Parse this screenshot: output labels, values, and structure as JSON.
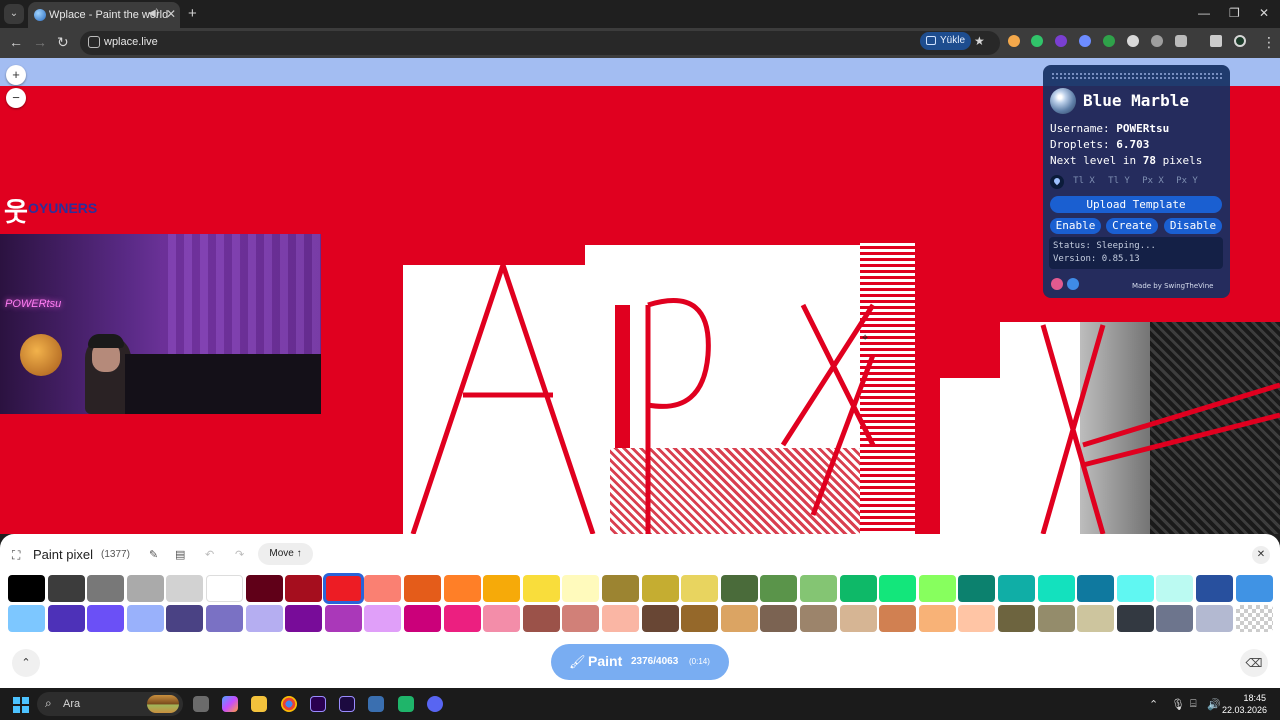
{
  "browser": {
    "tab_title": "Wplace - Paint the world",
    "url": "wplace.live",
    "install_label": "Yükle"
  },
  "stream_logo": {
    "word": "OYUNERS"
  },
  "webcam": {
    "neon_text": "POWERtsu"
  },
  "blue_marble": {
    "title": "Blue Marble",
    "username_label": "Username:",
    "username": "POWERtsu",
    "droplets_label": "Droplets:",
    "droplets": "6.703",
    "next_level_pre": "Next level in",
    "next_level_value": "78",
    "next_level_post": "pixels",
    "coord_placeholders": [
      "Tl X",
      "Tl Y",
      "Px X",
      "Px Y"
    ],
    "upload_label": "Upload Template",
    "enable_label": "Enable",
    "create_label": "Create",
    "disable_label": "Disable",
    "status": "Status: Sleeping...",
    "version": "Version: 0.85.13",
    "credit": "Made by SwingTheVine"
  },
  "paint_panel": {
    "title": "Paint pixel",
    "count": "(1377)",
    "move_label": "Move ↑",
    "paint_label": "Paint",
    "paint_count": "2376/4063",
    "paint_time": "(0:14)",
    "selected_color_index": 8,
    "palette_row1": [
      "#000000",
      "#3c3c3c",
      "#787878",
      "#aaaaaa",
      "#d2d2d2",
      "#ffffff",
      "#600018",
      "#a50e1e",
      "#ed1c24",
      "#fa8072",
      "#e45c1a",
      "#ff7f27",
      "#f6aa09",
      "#f9dd3b",
      "#fffabc",
      "#9c8431",
      "#c5ad31",
      "#e8d45f",
      "#4a6b3a",
      "#5a944a",
      "#84c573",
      "#0eb968",
      "#13e67b",
      "#87ff5e",
      "#0c816e",
      "#10aea6",
      "#13e1be",
      "#0f799f",
      "#60f7f2",
      "#bbfaf2",
      "#28509e",
      "#4093e4"
    ],
    "palette_row2": [
      "#7dc7ff",
      "#4d31b8",
      "#6b50f6",
      "#99b1fb",
      "#4a4284",
      "#7a71c4",
      "#b5aef1",
      "#780c99",
      "#aa38b9",
      "#e09ff9",
      "#cb007a",
      "#ec1f80",
      "#f38da9",
      "#9b5249",
      "#d18078",
      "#fab6a4",
      "#684634",
      "#95682a",
      "#dba463",
      "#7b6352",
      "#9c846b",
      "#d6b594",
      "#d18051",
      "#f8b277",
      "#ffc5a5",
      "#6d643f",
      "#948c6b",
      "#cdc59e",
      "#333941",
      "#6d758d",
      "#b3b9d1",
      "transparent"
    ]
  },
  "taskbar": {
    "search_text": "Ara",
    "time": "18:45",
    "date": "22.03.2026"
  }
}
